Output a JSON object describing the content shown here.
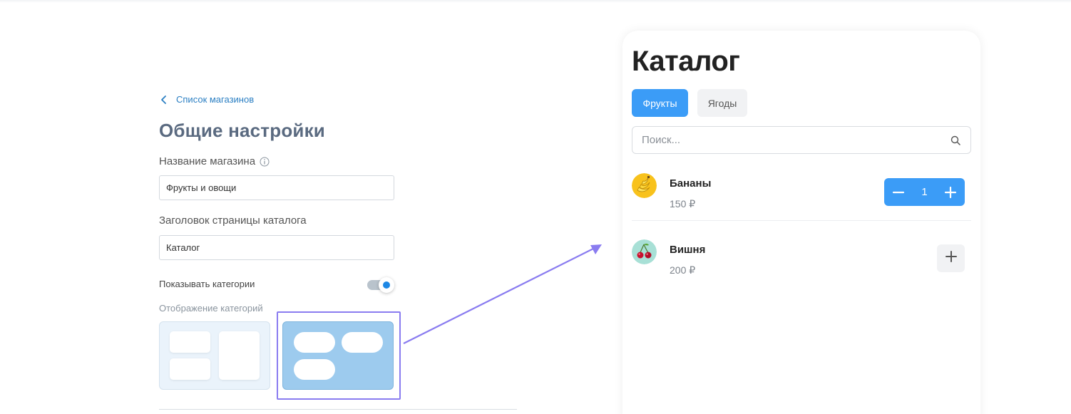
{
  "settings": {
    "back_link": "Список магазинов",
    "title": "Общие настройки",
    "store_name_label": "Название магазина",
    "store_name_value": "Фрукты и овощи",
    "catalog_title_label": "Заголовок страницы каталога",
    "catalog_title_value": "Каталог",
    "show_categories_label": "Показывать категории",
    "show_categories_enabled": true,
    "category_display_label": "Отображение категорий",
    "layout_options": [
      "grid-icon",
      "pills-icon"
    ],
    "selected_layout": "pills"
  },
  "catalog": {
    "title": "Каталог",
    "tabs": [
      {
        "label": "Фрукты",
        "active": true
      },
      {
        "label": "Ягоды",
        "active": false
      }
    ],
    "search_placeholder": "Поиск...",
    "products": [
      {
        "name": "Бананы",
        "price": "150 ₽",
        "image": "banana-icon",
        "quantity": "1"
      },
      {
        "name": "Вишня",
        "price": "200 ₽",
        "image": "cherry-icon",
        "quantity": null
      }
    ]
  },
  "colors": {
    "accent": "#3b9cf7",
    "link": "#2b7fc3",
    "highlight": "#8a7cf0",
    "title": "#5a6a80"
  }
}
